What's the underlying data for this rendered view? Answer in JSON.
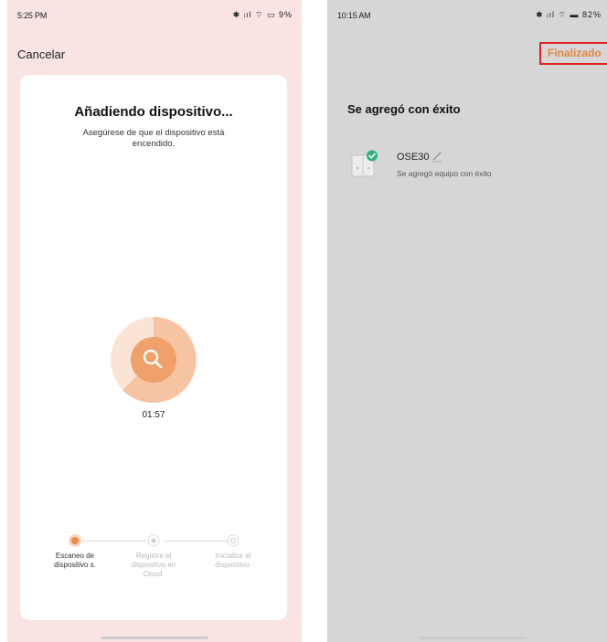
{
  "left_phone": {
    "status_time": "5:25 PM",
    "status_icons": "✱ ᵢıl ⌔ ▭ 9%",
    "cancel_label": "Cancelar",
    "title": "Añadiendo dispositivo...",
    "subtitle": "Asegúrese de que el dispositivo está encendido.",
    "timer": "01:57",
    "scan_icon": "search-icon",
    "accent": "#f0a06a",
    "steps": [
      {
        "label": "Escaneo de dispositivo s.",
        "state": "active"
      },
      {
        "label": "Registre el dispositivo en Cloud.",
        "state": "pending"
      },
      {
        "label": "Inicialice el dispositivo.",
        "state": "pending"
      }
    ]
  },
  "right_phone": {
    "status_time": "10:15 AM",
    "status_icons": "✱ ᵢıl ⌔ ▬ 82%",
    "done_label": "Finalizado",
    "title": "Se agregó con éxito",
    "device": {
      "name": "OSE30",
      "message": "Se agregó equipo con éxito",
      "status_color": "#2fb37c"
    }
  }
}
